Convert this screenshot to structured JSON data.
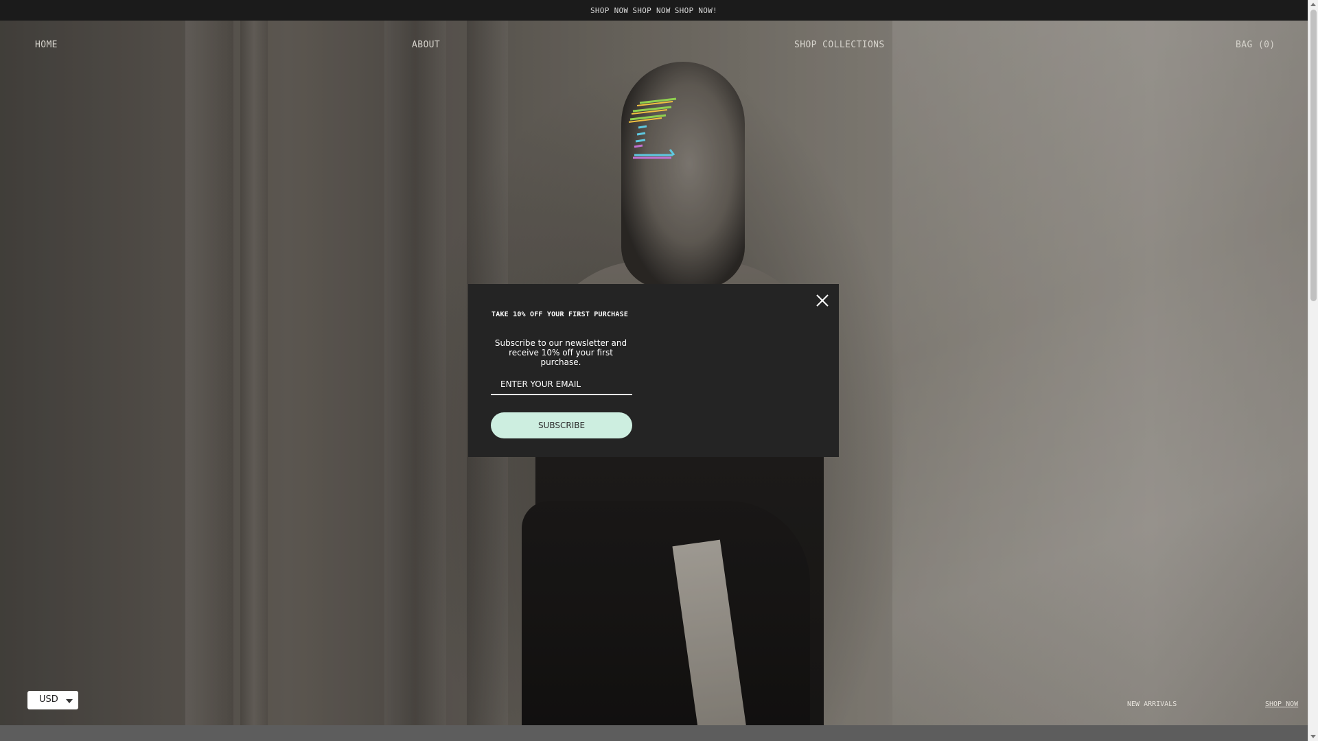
{
  "announcement": {
    "items": [
      "SHOP NOW",
      "SHOP NOW",
      "SHOP NOW!"
    ]
  },
  "nav": {
    "home": "HOME",
    "about": "ABOUT",
    "collections": "SHOP COLLECTIONS",
    "bag": "BAG (0)"
  },
  "logo": {
    "icon": "brand-logo-icon",
    "colors": [
      "#8fd14f",
      "#f0c040",
      "#5ec8e0",
      "#c070d0"
    ]
  },
  "popup": {
    "title": "TAKE 10% OFF YOUR FIRST PURCHASE",
    "description": "Subscribe to our newsletter and receive 10% off your first purchase.",
    "email_placeholder": "ENTER YOUR EMAIL",
    "email_value": "",
    "subscribe_label": "SUBSCRIBE",
    "close_icon": "close-icon",
    "button_color": "#cdeee0"
  },
  "currency": {
    "selected": "USD"
  },
  "hero": {
    "caption": "NEW ARRIVALS",
    "cta": "SHOP NOW"
  }
}
